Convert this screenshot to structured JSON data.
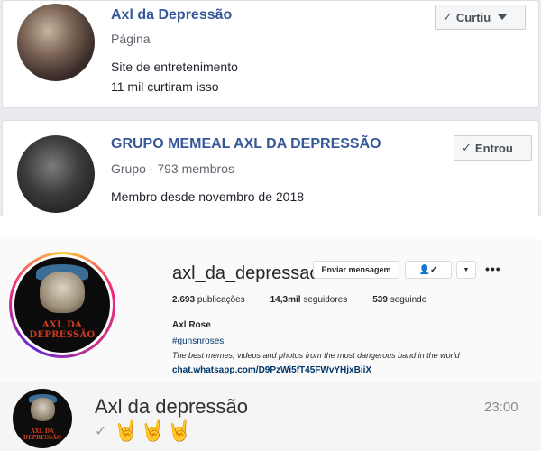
{
  "facebook": {
    "cards": [
      {
        "title": "Axl da Depressão",
        "subtitle": "Página",
        "line1": "Site de entretenimento",
        "line2": "11 mil curtiram isso",
        "button_label": "Curtiu",
        "button_icon": "check-icon"
      },
      {
        "title": "GRUPO MEMEAL AXL DA DEPRESSÃO",
        "subtitle": "Grupo · 793 membros",
        "line1": "Membro desde novembro de 2018",
        "button_label": "Entrou",
        "button_icon": "check-icon"
      }
    ]
  },
  "instagram": {
    "username": "axl_da_depressao",
    "message_button": "Enviar mensagem",
    "follow_icon": "person-check-icon",
    "more_icon": "ellipsis-icon",
    "posts_count": "2.693",
    "posts_label": "publicações",
    "followers_count": "14,3mil",
    "followers_label": "seguidores",
    "following_count": "539",
    "following_label": "seguindo",
    "name": "Axl Rose",
    "hashtag": "#gunsnroses",
    "bio": "The best memes, videos and photos from the most dangerous band in the world",
    "link": "chat.whatsapp.com/D9PzWi5fT45FWvYHjxBiiX",
    "avatar_logo_text": "AXL DA DEPRESSÃO"
  },
  "whatsapp": {
    "chat_name": "Axl da depressão",
    "time": "23:00",
    "message_emojis": [
      "🤘",
      "🤘",
      "🤘"
    ]
  }
}
